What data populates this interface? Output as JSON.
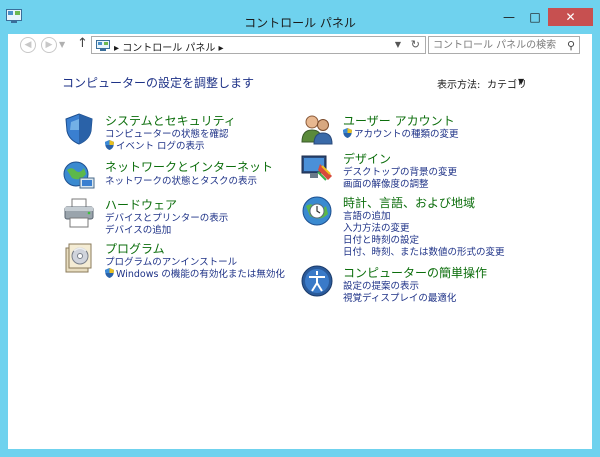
{
  "window": {
    "title": "コントロール パネル",
    "controls": {
      "minimize": "—",
      "maximize": "□",
      "close": "✕"
    }
  },
  "navbar": {
    "back_icon": "back-arrow-icon",
    "forward_icon": "forward-arrow-icon",
    "up_icon": "up-arrow-icon",
    "address": "▸ コントロール パネル ▸",
    "search_placeholder": "コントロール パネルの検索"
  },
  "main": {
    "heading": "コンピューターの設定を調整します",
    "view_by_label": "表示方法:",
    "view_by_value": "カテゴリ"
  },
  "categories_left": [
    {
      "title": "システムとセキュリティ",
      "icon": "shield-icon",
      "links": [
        "コンピューターの状態を確認",
        "イベント ログの表示"
      ],
      "shield_links": [
        false,
        true
      ]
    },
    {
      "title": "ネットワークとインターネット",
      "icon": "network-icon",
      "links": [
        "ネットワークの状態とタスクの表示"
      ],
      "shield_links": [
        false
      ]
    },
    {
      "title": "ハードウェア",
      "icon": "printer-icon",
      "links": [
        "デバイスとプリンターの表示",
        "デバイスの追加"
      ],
      "shield_links": [
        false,
        false
      ]
    },
    {
      "title": "プログラム",
      "icon": "programs-icon",
      "links": [
        "プログラムのアンインストール",
        "Windows の機能の有効化または無効化"
      ],
      "shield_links": [
        false,
        true
      ]
    }
  ],
  "categories_right": [
    {
      "title": "ユーザー アカウント",
      "icon": "users-icon",
      "links": [
        "アカウントの種類の変更"
      ],
      "shield_links": [
        true
      ]
    },
    {
      "title": "デザイン",
      "icon": "appearance-icon",
      "links": [
        "デスクトップの背景の変更",
        "画面の解像度の調整"
      ],
      "shield_links": [
        false,
        false
      ]
    },
    {
      "title": "時計、言語、および地域",
      "icon": "globe-clock-icon",
      "links": [
        "言語の追加",
        "入力方法の変更",
        "日付と時刻の設定",
        "日付、時刻、または数値の形式の変更"
      ],
      "shield_links": [
        false,
        false,
        false,
        false
      ]
    },
    {
      "title": "コンピューターの簡単操作",
      "icon": "ease-of-access-icon",
      "links": [
        "設定の提案の表示",
        "視覚ディスプレイの最適化"
      ],
      "shield_links": [
        false,
        false
      ]
    }
  ],
  "colors": {
    "frame": "#6fd2ee",
    "close_button": "#c75050",
    "category_title": "#0c6e0c",
    "link": "#1e3287"
  }
}
